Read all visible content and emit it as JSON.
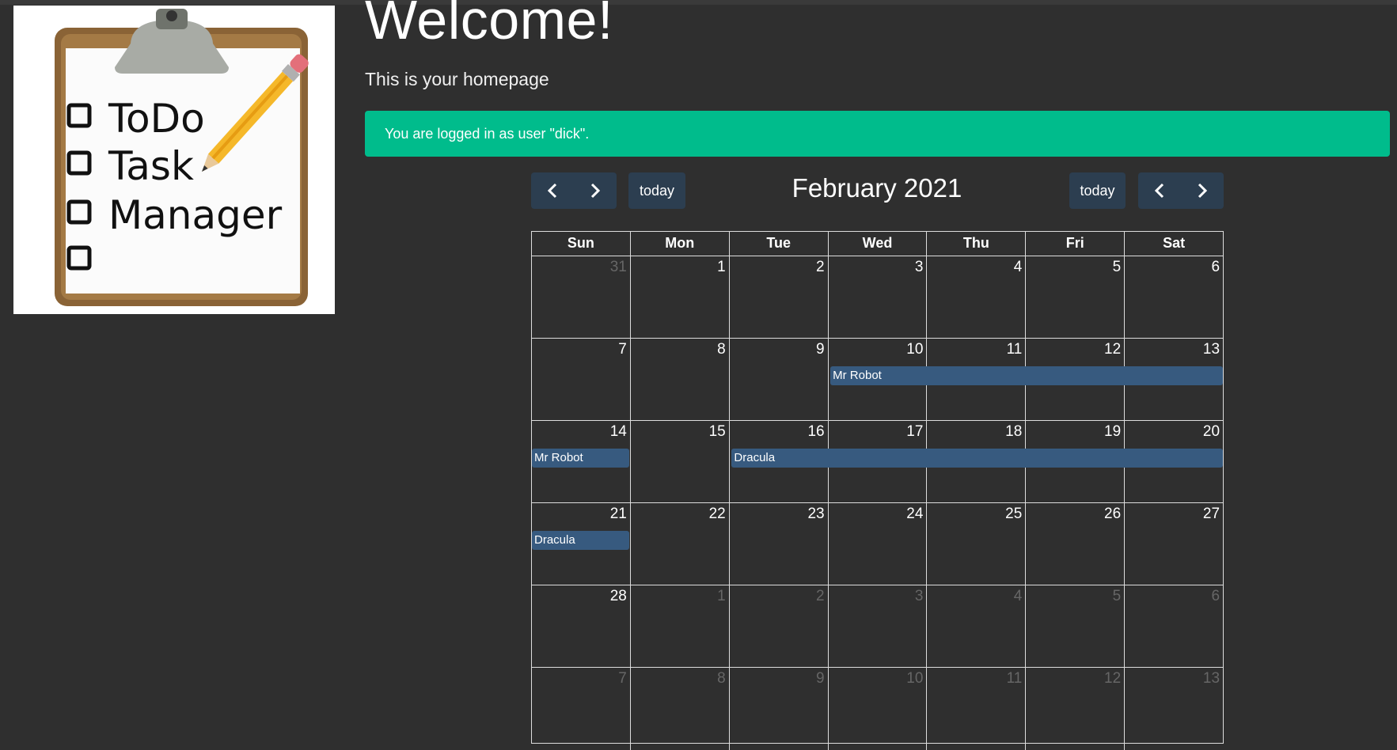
{
  "header": {
    "title": "Welcome!",
    "subtitle": "This is your homepage",
    "alert": "You are logged in as user \"dick\"."
  },
  "logo": {
    "lines": [
      "ToDo",
      "Task",
      "Manager",
      ""
    ]
  },
  "calendar": {
    "title": "February 2021",
    "today_label": "today",
    "prev_icon": "chevron-left-icon",
    "next_icon": "chevron-right-icon",
    "day_names": [
      "Sun",
      "Mon",
      "Tue",
      "Wed",
      "Thu",
      "Fri",
      "Sat"
    ],
    "weeks": [
      [
        {
          "n": "31",
          "other": true
        },
        {
          "n": "1"
        },
        {
          "n": "2"
        },
        {
          "n": "3"
        },
        {
          "n": "4"
        },
        {
          "n": "5"
        },
        {
          "n": "6"
        }
      ],
      [
        {
          "n": "7"
        },
        {
          "n": "8"
        },
        {
          "n": "9"
        },
        {
          "n": "10"
        },
        {
          "n": "11"
        },
        {
          "n": "12"
        },
        {
          "n": "13"
        }
      ],
      [
        {
          "n": "14"
        },
        {
          "n": "15"
        },
        {
          "n": "16"
        },
        {
          "n": "17"
        },
        {
          "n": "18"
        },
        {
          "n": "19"
        },
        {
          "n": "20"
        }
      ],
      [
        {
          "n": "21"
        },
        {
          "n": "22"
        },
        {
          "n": "23"
        },
        {
          "n": "24"
        },
        {
          "n": "25"
        },
        {
          "n": "26"
        },
        {
          "n": "27"
        }
      ],
      [
        {
          "n": "28"
        },
        {
          "n": "1",
          "other": true
        },
        {
          "n": "2",
          "other": true
        },
        {
          "n": "3",
          "other": true
        },
        {
          "n": "4",
          "other": true
        },
        {
          "n": "5",
          "other": true
        },
        {
          "n": "6",
          "other": true
        }
      ],
      [
        {
          "n": "7",
          "other": true
        },
        {
          "n": "8",
          "other": true
        },
        {
          "n": "9",
          "other": true
        },
        {
          "n": "10",
          "other": true
        },
        {
          "n": "11",
          "other": true
        },
        {
          "n": "12",
          "other": true
        },
        {
          "n": "13",
          "other": true
        }
      ]
    ],
    "events": [
      {
        "title": "Mr Robot",
        "week": 1,
        "start": 3,
        "end": 6
      },
      {
        "title": "Mr Robot",
        "week": 2,
        "start": 0,
        "end": 0
      },
      {
        "title": "Dracula",
        "week": 2,
        "start": 2,
        "end": 6
      },
      {
        "title": "Dracula",
        "week": 3,
        "start": 0,
        "end": 0
      }
    ]
  },
  "colors": {
    "background": "#2f2f2f",
    "alert": "#00bc8c",
    "button": "#2c3e50",
    "event": "#375a7f"
  }
}
